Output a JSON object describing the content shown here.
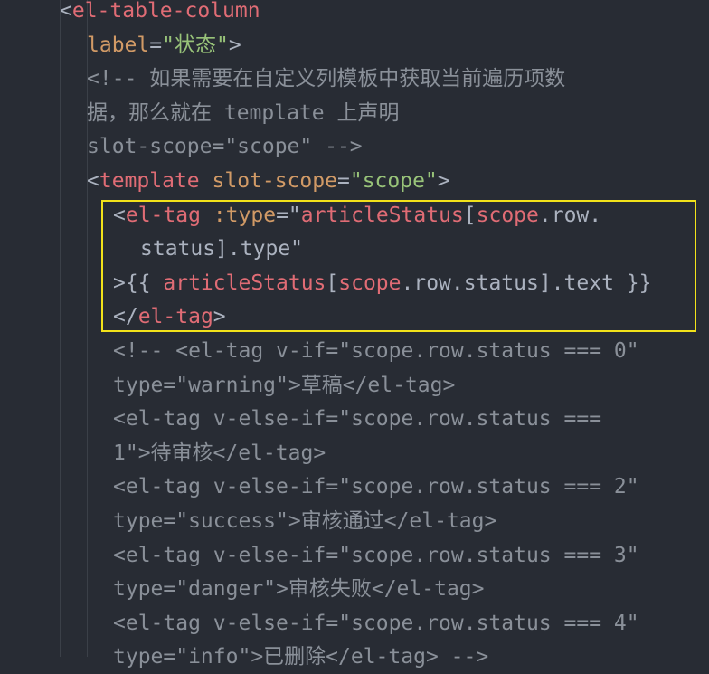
{
  "code_lines": [
    {
      "indent": 66,
      "tokens": [
        {
          "cls": "t-punc",
          "text": "<"
        },
        {
          "cls": "t-tag",
          "text": "el-table-column"
        }
      ]
    },
    {
      "indent": 96,
      "tokens": [
        {
          "cls": "t-attr",
          "text": "label"
        },
        {
          "cls": "t-punc",
          "text": "="
        },
        {
          "cls": "t-str",
          "text": "\"状态\""
        },
        {
          "cls": "t-punc",
          "text": ">"
        }
      ]
    },
    {
      "indent": 96,
      "tokens": [
        {
          "cls": "t-com",
          "text": "<!-- 如果需要在自定义列模板中获取当前遍历项数"
        }
      ]
    },
    {
      "indent": 96,
      "tokens": [
        {
          "cls": "t-com",
          "text": "据，那么就在 template 上声明"
        }
      ]
    },
    {
      "indent": 96,
      "tokens": [
        {
          "cls": "t-com",
          "text": "slot-scope=\"scope\" -->"
        }
      ]
    },
    {
      "indent": 96,
      "tokens": [
        {
          "cls": "t-punc",
          "text": "<"
        },
        {
          "cls": "t-tag",
          "text": "template"
        },
        {
          "cls": "t-punc",
          "text": " "
        },
        {
          "cls": "t-attr",
          "text": "slot-scope"
        },
        {
          "cls": "t-punc",
          "text": "="
        },
        {
          "cls": "t-str",
          "text": "\"scope\""
        },
        {
          "cls": "t-punc",
          "text": ">"
        }
      ]
    },
    {
      "indent": 125,
      "tokens": [
        {
          "cls": "t-punc",
          "text": "<"
        },
        {
          "cls": "t-tag",
          "text": "el-tag"
        },
        {
          "cls": "t-punc",
          "text": " "
        },
        {
          "cls": "t-attr",
          "text": ":type"
        },
        {
          "cls": "t-punc",
          "text": "=\""
        },
        {
          "cls": "t-tag",
          "text": "articleStatus"
        },
        {
          "cls": "t-punc",
          "text": "["
        },
        {
          "cls": "t-tag",
          "text": "scope"
        },
        {
          "cls": "t-punc",
          "text": ".row."
        }
      ]
    },
    {
      "indent": 155,
      "tokens": [
        {
          "cls": "t-plain",
          "text": "status].type\""
        }
      ]
    },
    {
      "indent": 125,
      "tokens": [
        {
          "cls": "t-punc",
          "text": ">{{ "
        },
        {
          "cls": "t-tag",
          "text": "articleStatus"
        },
        {
          "cls": "t-punc",
          "text": "["
        },
        {
          "cls": "t-tag",
          "text": "scope"
        },
        {
          "cls": "t-punc",
          "text": ".row.status].text }}"
        }
      ]
    },
    {
      "indent": 125,
      "tokens": [
        {
          "cls": "t-punc",
          "text": "</"
        },
        {
          "cls": "t-tag",
          "text": "el-tag"
        },
        {
          "cls": "t-punc",
          "text": ">"
        }
      ]
    },
    {
      "indent": 125,
      "tokens": [
        {
          "cls": "t-com",
          "text": "<!-- <el-tag v-if=\"scope.row.status === 0\""
        }
      ]
    },
    {
      "indent": 125,
      "tokens": [
        {
          "cls": "t-com",
          "text": "type=\"warning\">草稿</el-tag>"
        }
      ]
    },
    {
      "indent": 125,
      "tokens": [
        {
          "cls": "t-com",
          "text": "<el-tag v-else-if=\"scope.row.status ==="
        }
      ]
    },
    {
      "indent": 125,
      "tokens": [
        {
          "cls": "t-com",
          "text": "1\">待审核</el-tag>"
        }
      ]
    },
    {
      "indent": 125,
      "tokens": [
        {
          "cls": "t-com",
          "text": "<el-tag v-else-if=\"scope.row.status === 2\""
        }
      ]
    },
    {
      "indent": 125,
      "tokens": [
        {
          "cls": "t-com",
          "text": "type=\"success\">审核通过</el-tag>"
        }
      ]
    },
    {
      "indent": 125,
      "tokens": [
        {
          "cls": "t-com",
          "text": "<el-tag v-else-if=\"scope.row.status === 3\""
        }
      ]
    },
    {
      "indent": 125,
      "tokens": [
        {
          "cls": "t-com",
          "text": "type=\"danger\">审核失败</el-tag>"
        }
      ]
    },
    {
      "indent": 125,
      "tokens": [
        {
          "cls": "t-com",
          "text": "<el-tag v-else-if=\"scope.row.status === 4\""
        }
      ]
    },
    {
      "indent": 125,
      "tokens": [
        {
          "cls": "t-com",
          "text": "type=\"info\">已删除</el-tag> -->"
        }
      ]
    }
  ],
  "colors": {
    "background": "#282c34",
    "tag": "#e06c75",
    "attribute": "#d19a66",
    "string": "#98c379",
    "comment": "#8a9099",
    "highlight_border": "#f2e21a"
  }
}
